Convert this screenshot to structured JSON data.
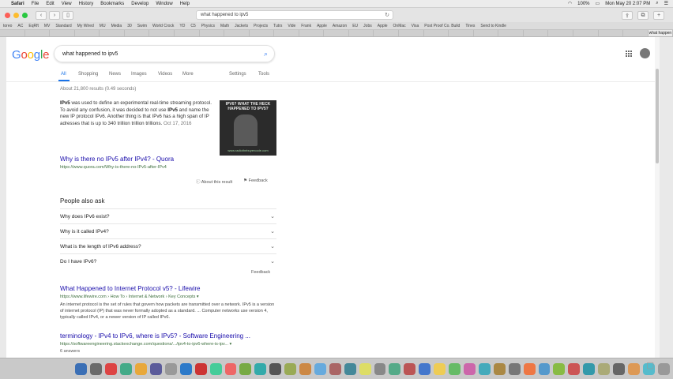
{
  "menubar": {
    "app": "Safari",
    "items": [
      "File",
      "Edit",
      "View",
      "History",
      "Bookmarks",
      "Develop",
      "Window",
      "Help"
    ],
    "battery": "100%",
    "clock": "Mon May 20  2:07 PM"
  },
  "toolbar": {
    "url": "what happened to ipv5"
  },
  "bookmarks": [
    "toreo",
    "AC",
    "EqRft",
    "MV",
    "Standard",
    "My Wired",
    "MU",
    "Media",
    "30",
    "Swim",
    "World Crock",
    "YD",
    "C5",
    "Physics",
    "Math",
    "Jackets",
    "Projects",
    "Tutrs",
    "Vide",
    "Frank",
    "Apple",
    "Amazon",
    "EU",
    "Jobs",
    "Apple",
    "OnMac",
    "Visa",
    "Post Proof Co. Build",
    "Tines",
    "Send to Kindle"
  ],
  "tabs": [
    "",
    "",
    "",
    "",
    "",
    "",
    "",
    "",
    "",
    "",
    "",
    "",
    "",
    "",
    "",
    "",
    "",
    "",
    "",
    "",
    "",
    "",
    "",
    "",
    "",
    "",
    "what happen"
  ],
  "google": {
    "logo": "Google",
    "query": "what happened to ipv5",
    "nav": [
      "All",
      "Shopping",
      "News",
      "Images",
      "Videos",
      "More"
    ],
    "settings": "Settings",
    "tools": "Tools",
    "stats": "About 21,800 results (0.49 seconds)"
  },
  "snippet": {
    "bold_start": "IPv5",
    "text_1": " was used to define an experimental real-time streaming protocol. To avoid any confusion, it was decided to not use ",
    "bold_mid": "IPv5",
    "text_2": " and name the new IP protocol IPv6. Another thing is that IPv6 has a high span of IP adresses that is up to 340 trillion trillion trillions.",
    "date": "Oct 17, 2016",
    "image_caption": "IPV6? WHAT THE HECK HAPPENED TO IPV5?",
    "image_watermark": "www.radiothebuyercode.com",
    "title": "Why is there no IPv5 after IPv4? - Quora",
    "url": "https://www.quora.com/Why-is-there-no-IPv5-after-IPv4",
    "about": "About this result",
    "feedback": "Feedback"
  },
  "paa": {
    "title": "People also ask",
    "questions": [
      "Why does IPv6 exist?",
      "Why is it called IPv4?",
      "What is the length of IPv6 address?",
      "Do I have IPv6?"
    ],
    "feedback": "Feedback"
  },
  "results": [
    {
      "title": "What Happened to Internet Protocol v5? - Lifewire",
      "url": "https://www.lifewire.com › How To › Internet & Network › Key Concepts ▾",
      "snippet": "An internet protocol is the set of rules that govern how packets are transmitted over a network. IPv5 is a version of internet protocol (IP) that was never formally adopted as a standard. ... Computer networks use version 4, typically called IPv4, or a newer version of IP called IPv6."
    },
    {
      "title": "terminology - IPv4 to IPv6, where is IPv5? - Software Engineering ...",
      "url": "https://softwareengineering.stackexchange.com/questions/.../ipv4-to-ipv6-where-is-ipv... ▾",
      "meta": "6 answers"
    }
  ],
  "colors": {
    "link": "#1a0dab",
    "url_green": "#3c6e3c",
    "google_blue": "#4285f4",
    "google_red": "#ea4335",
    "google_yellow": "#fbbc05",
    "google_green": "#34a853"
  }
}
